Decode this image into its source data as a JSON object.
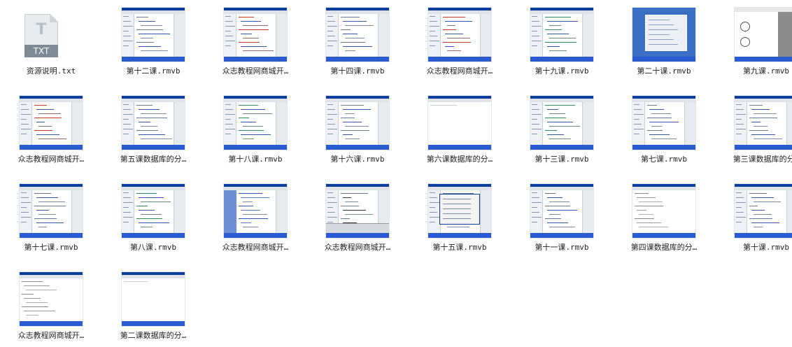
{
  "files": [
    {
      "name": "资源说明.txt",
      "type": "txt",
      "icon_text": "TXT",
      "icon_letter": "T"
    },
    {
      "name": "第十二课.rmvb",
      "type": "video",
      "thumb": "ide"
    },
    {
      "name": "众志教程网商城开…",
      "type": "video",
      "thumb": "ide-red"
    },
    {
      "name": "第十四课.rmvb",
      "type": "video",
      "thumb": "ide"
    },
    {
      "name": "众志教程网商城开…",
      "type": "video",
      "thumb": "ide-red"
    },
    {
      "name": "第十九课.rmvb",
      "type": "video",
      "thumb": "ide-green"
    },
    {
      "name": "第二十课.rmvb",
      "type": "video",
      "thumb": "desktop"
    },
    {
      "name": "第九课.rmvb",
      "type": "video",
      "thumb": "diagram"
    },
    {
      "name": "众志教程网商城开…",
      "type": "video",
      "thumb": "ide-red"
    },
    {
      "name": "第五课数据库的分…",
      "type": "video",
      "thumb": "ide"
    },
    {
      "name": "第十八课.rmvb",
      "type": "video",
      "thumb": "ide-green"
    },
    {
      "name": "第十六课.rmvb",
      "type": "video",
      "thumb": "ide"
    },
    {
      "name": "第六课数据库的分…",
      "type": "video",
      "thumb": "blank"
    },
    {
      "name": "第十三课.rmvb",
      "type": "video",
      "thumb": "ide-green"
    },
    {
      "name": "第七课.rmvb",
      "type": "video",
      "thumb": "ide"
    },
    {
      "name": "第三课数据库的分…",
      "type": "video",
      "thumb": "ide"
    },
    {
      "name": "第十七课.rmvb",
      "type": "video",
      "thumb": "ide"
    },
    {
      "name": "第八课.rmvb",
      "type": "video",
      "thumb": "ide-green"
    },
    {
      "name": "众志教程网商城开…",
      "type": "video",
      "thumb": "explorer"
    },
    {
      "name": "众志教程网商城开…",
      "type": "video",
      "thumb": "ide-dark"
    },
    {
      "name": "第十五课.rmvb",
      "type": "video",
      "thumb": "dialog"
    },
    {
      "name": "第十一课.rmvb",
      "type": "video",
      "thumb": "ide"
    },
    {
      "name": "第四课数据库的分…",
      "type": "video",
      "thumb": "text"
    },
    {
      "name": "第十课.rmvb",
      "type": "video",
      "thumb": "ide"
    },
    {
      "name": "众志教程网商城开…",
      "type": "video",
      "thumb": "text"
    },
    {
      "name": "第二课数据库的分…",
      "type": "video",
      "thumb": "blank"
    }
  ]
}
